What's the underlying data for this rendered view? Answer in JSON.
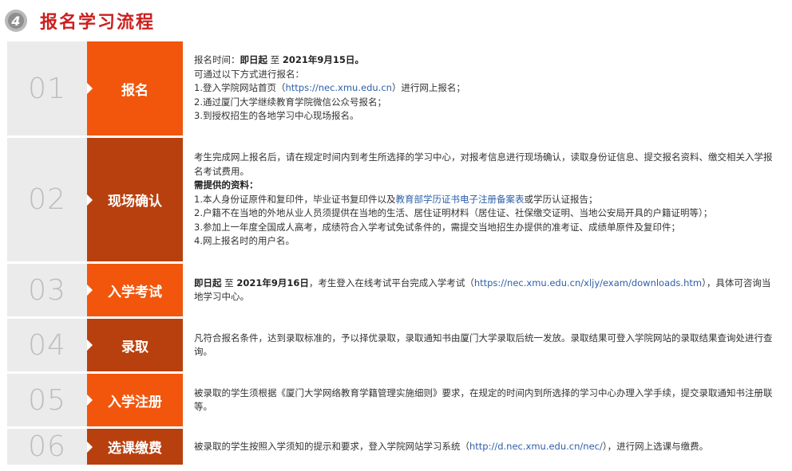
{
  "header": {
    "badge": "4",
    "title": "报名学习流程"
  },
  "steps": [
    {
      "num": "01",
      "label": "报名",
      "lines": [
        {
          "a": "报名时间：",
          "b": "即日起",
          "c": " 至 ",
          "d": "2021年9月15日。"
        },
        {
          "a": "可通过以下方式进行报名："
        },
        {
          "a": "1.登入学院网站首页（",
          "link": "https://nec.xmu.edu.cn",
          "c": "）进行网上报名；"
        },
        {
          "a": "2.通过厦门大学继续教育学院微信公众号报名；"
        },
        {
          "a": "3.到授权招生的各地学习中心现场报名。"
        }
      ]
    },
    {
      "num": "02",
      "label": "现场确认",
      "lines": [
        {
          "a": "考生完成网上报名后，请在规定时间内到考生所选择的学习中心，对报考信息进行现场确认，读取身份证信息、提交报名资料、缴交相关入学报名考试费用。"
        },
        {
          "b": "需提供的资料："
        },
        {
          "a": "1.本人身份证原件和复印件，毕业证书复印件以及",
          "link": "教育部学历证书电子注册备案表",
          "c": "或学历认证报告；"
        },
        {
          "a": "2.户籍不在当地的外地从业人员须提供在当地的生活、居住证明材料（居住证、社保缴交证明、当地公安局开具的户籍证明等）；"
        },
        {
          "a": "3.参加上一年度全国成人高考，成绩符合入学考试免试条件的，需提交当地招生办提供的准考证、成绩单原件及复印件；"
        },
        {
          "a": "4.网上报名时的用户名。"
        }
      ]
    },
    {
      "num": "03",
      "label": "入学考试",
      "lines": [
        {
          "b": "即日起",
          "c": " 至 ",
          "d": "2021年9月16日",
          "e": "，考生登入在线考试平台完成入学考试（",
          "f": "https://nec.xmu.edu.cn/xljy/exam/downloads.htm",
          "g": "），具体可咨询当地学习中心。"
        }
      ]
    },
    {
      "num": "04",
      "label": "录取",
      "lines": [
        {
          "a": "凡符合报名条件，达到录取标准的，予以择优录取，录取通知书由厦门大学录取后统一发放。录取结果可登入学院网站的录取结果查询处进行查询。"
        }
      ]
    },
    {
      "num": "05",
      "label": "入学注册",
      "lines": [
        {
          "a": "被录取的学生须根据《厦门大学网络教育学籍管理实施细则》要求，在规定的时间内到所选择的学习中心办理入学手续，提交录取通知书注册联等。"
        }
      ]
    },
    {
      "num": "06",
      "label": "选课缴费",
      "lines": [
        {
          "a": "被录取的学生按照入学须知的提示和要求，登入学院网站学习系统（",
          "f": "http://d.nec.xmu.edu.cn/nec/",
          "g": "），进行网上选课与缴费。"
        }
      ]
    }
  ]
}
